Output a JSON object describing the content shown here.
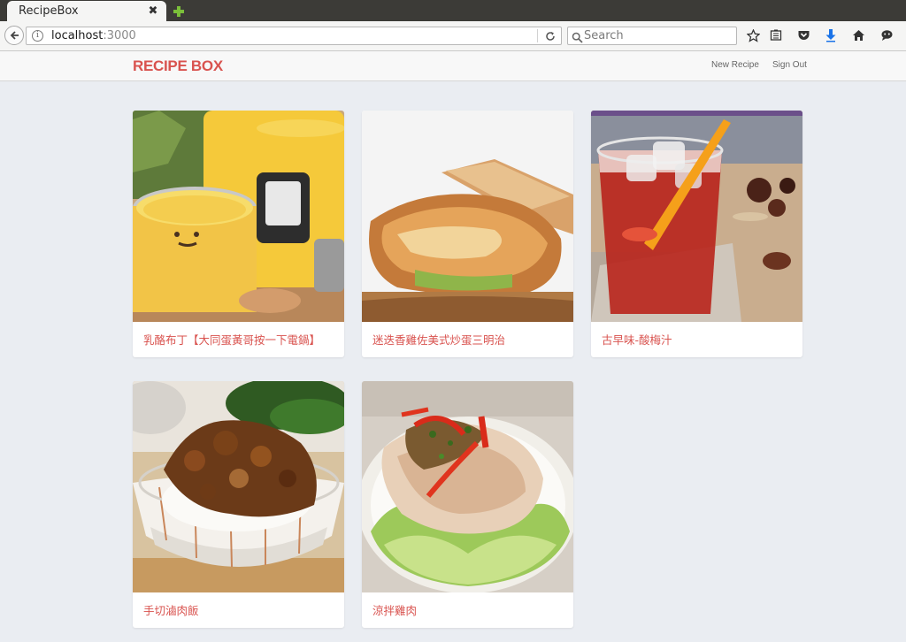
{
  "browser": {
    "tab_title": "RecipeBox",
    "tab_close": "✖",
    "url_host": "localhost",
    "url_port": ":3000",
    "search_placeholder": "Search"
  },
  "app": {
    "brand": "RECIPE BOX",
    "nav": {
      "new_recipe": "New Recipe",
      "sign_out": "Sign Out"
    }
  },
  "recipes": [
    {
      "title": "乳酪布丁【大同蛋黃哥按一下電鍋】"
    },
    {
      "title": "迷迭香雞佐美式炒蛋三明治"
    },
    {
      "title": "古早味-酸梅汁"
    },
    {
      "title": "手切滷肉飯"
    },
    {
      "title": "涼拌雞肉"
    }
  ],
  "colors": {
    "brand": "#d9534f",
    "page_background": "#eaedf2"
  }
}
